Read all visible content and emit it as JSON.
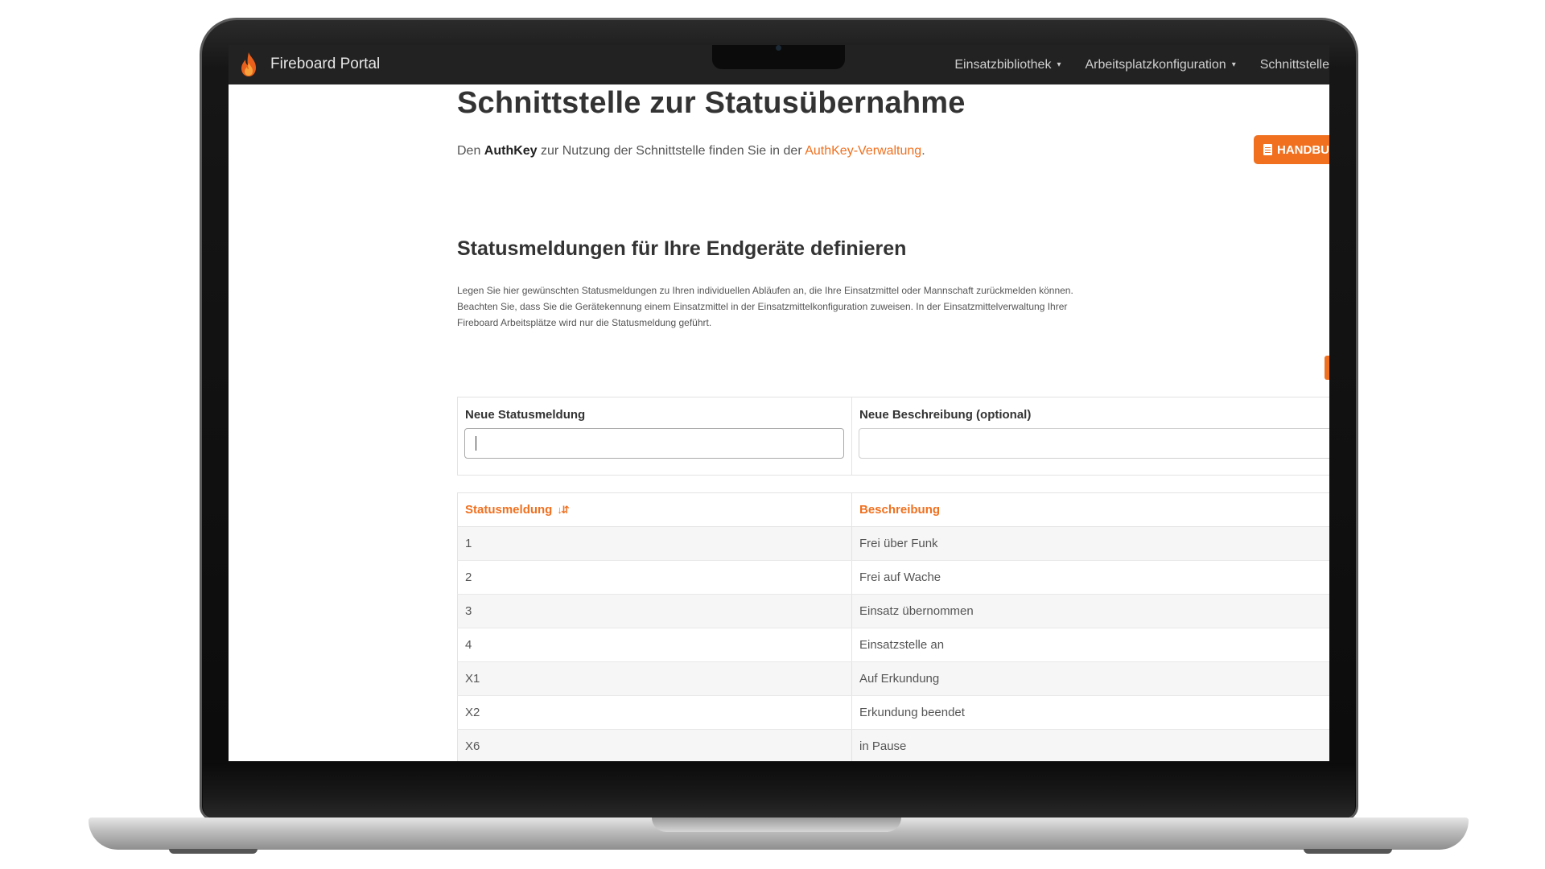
{
  "app": {
    "brand": "Fireboard Portal"
  },
  "nav": {
    "items": [
      {
        "label": "Einsatzbibliothek",
        "caret": "▾"
      },
      {
        "label": "Arbeitsplatzkonfiguration",
        "caret": "▾"
      },
      {
        "label": "Schnittstelle"
      }
    ]
  },
  "page": {
    "title": "Schnittstelle zur Statusübernahme",
    "manual_button": "HANDBU",
    "intro": {
      "prefix": "Den ",
      "bold": "AuthKey",
      "middle": " zur Nutzung der Schnittstelle finden Sie in der ",
      "link": "AuthKey-Verwaltung",
      "suffix": "."
    }
  },
  "section": {
    "title": "Statusmeldungen für Ihre Endgeräte definieren",
    "description": "Legen Sie hier gewünschten Statusmeldungen zu Ihren individuellen Abläufen an, die Ihre Einsatzmittel oder Mannschaft zurückmelden können. Beachten Sie, dass Sie die Gerätekennung einem Einsatzmittel in der Einsatzmittelkonfiguration zuweisen. In der Einsatzmittelverwaltung Ihrer Fireboard Arbeitsplätze wird nur die Statusmeldung geführt."
  },
  "form": {
    "status_label": "Neue Statusmeldung",
    "status_value": "",
    "description_label": "Neue Beschreibung (optional)",
    "description_value": ""
  },
  "table": {
    "headers": {
      "status": "Statusmeldung",
      "description": "Beschreibung"
    },
    "rows": [
      {
        "status": "1",
        "description": "Frei über Funk"
      },
      {
        "status": "2",
        "description": "Frei auf Wache"
      },
      {
        "status": "3",
        "description": "Einsatz übernommen"
      },
      {
        "status": "4",
        "description": "Einsatzstelle an"
      },
      {
        "status": "X1",
        "description": "Auf Erkundung"
      },
      {
        "status": "X2",
        "description": "Erkundung beendet"
      },
      {
        "status": "X6",
        "description": "in Pause"
      }
    ]
  },
  "colors": {
    "accent": "#f0701f",
    "navbar": "#222222"
  }
}
